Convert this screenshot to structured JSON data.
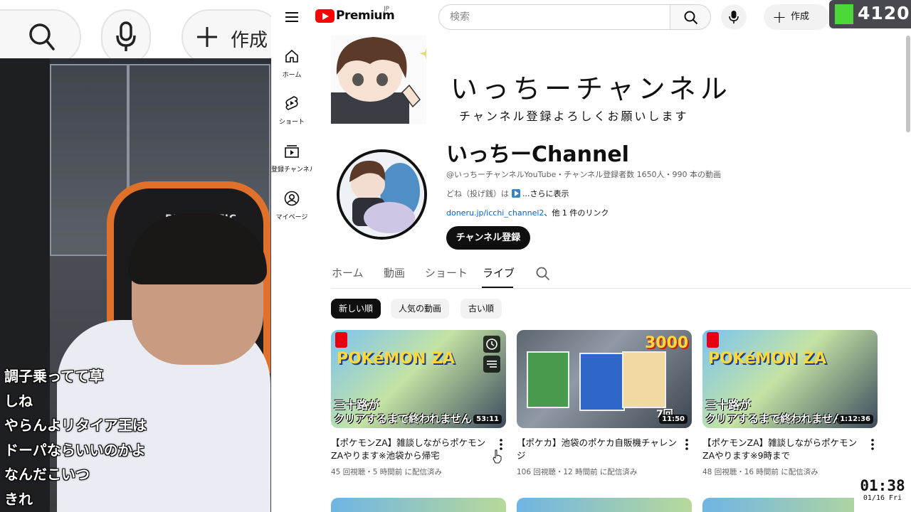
{
  "overlay": {
    "zoomed_create_label": "作成",
    "chair_brand": "PRAGMATIC",
    "comments": [
      "調子乗ってて草",
      "しね",
      "やらんよリタイア王は",
      "ドーパならいいのかよ",
      "なんだこいつ",
      "きれ"
    ]
  },
  "header": {
    "logo_text": "Premium",
    "logo_region": "JP",
    "search_placeholder": "検索",
    "create_label": "作成",
    "viewer_count": "4120"
  },
  "nav": {
    "items": [
      {
        "label": "ホーム",
        "icon": "home-icon"
      },
      {
        "label": "ショート",
        "icon": "shorts-icon"
      },
      {
        "label": "登録チャンネル",
        "icon": "subscriptions-icon"
      },
      {
        "label": "マイページ",
        "icon": "you-icon"
      }
    ]
  },
  "banner": {
    "title": "いっちーチャンネル",
    "subtitle": "チャンネル登録よろしくお願いします"
  },
  "channel": {
    "name": "いっちーChannel",
    "meta": "@いっちーチャンネルYouTube・チャンネル登録者数 1650人・990 本の動画",
    "description_prefix": "どね（投げ銭）は",
    "description_more": "...さらに表示",
    "link_url": "doneru.jp/icchi_channel2",
    "link_more": "、他 1 件のリンク",
    "subscribe_label": "チャンネル登録"
  },
  "tabs": [
    {
      "label": "ホーム",
      "active": false
    },
    {
      "label": "動画",
      "active": false
    },
    {
      "label": "ショート",
      "active": false
    },
    {
      "label": "ライブ",
      "active": true
    }
  ],
  "chips": [
    {
      "label": "新しい順",
      "selected": true
    },
    {
      "label": "人気の動画",
      "selected": false
    },
    {
      "label": "古い順",
      "selected": false
    }
  ],
  "videos": [
    {
      "title": "【ポケモンZA】雑談しながらポケモンZAやります※池袋から帰宅",
      "meta": "45 回視聴・5 時間前 に配信済み",
      "duration": "53:11",
      "thumb_text_1": "三十路が",
      "thumb_text_2": "クリアするまで終われません",
      "thumb_brand": "POKéMON ZA"
    },
    {
      "title": "【ポケカ】池袋のポケカ自販機チャレンジ",
      "meta": "106 回視聴・12 時間前 に配信済み",
      "duration": "11:50",
      "thumb_text_1": "3000",
      "thumb_text_2": "7回",
      "thumb_brand": ""
    },
    {
      "title": "【ポケモンZA】雑談しながらポケモンZAやります※9時まで",
      "meta": "48 回視聴・16 時間前 に配信済み",
      "duration": "1:12:36",
      "thumb_text_1": "三十路が",
      "thumb_text_2": "クリアするまで終われません",
      "thumb_brand": "POKéMON ZA"
    }
  ],
  "clock": {
    "time": "01:38",
    "date": "01/16 Fri"
  },
  "colors": {
    "brand_red": "#ff0000",
    "link_blue": "#065fd4",
    "badge_green": "#4dd83a"
  }
}
